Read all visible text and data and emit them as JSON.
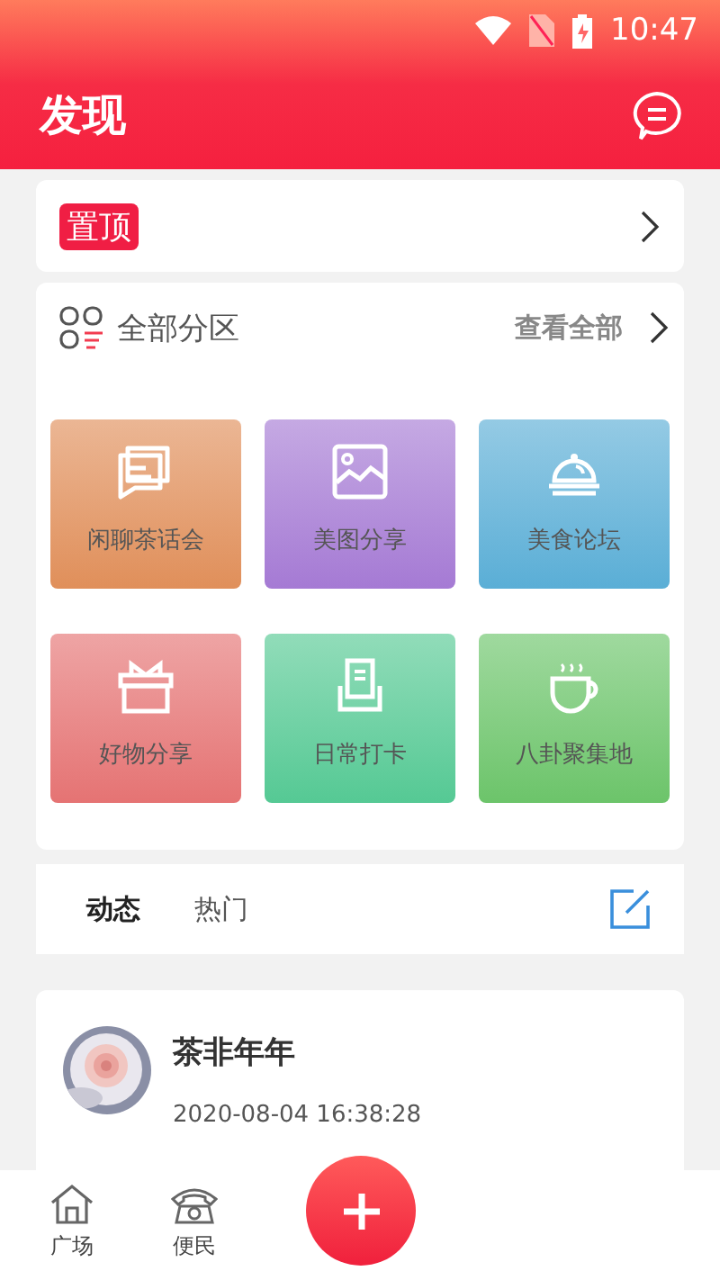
{
  "status_bar": {
    "time": "10:47"
  },
  "header": {
    "title": "发现"
  },
  "pinned": {
    "label": "置顶"
  },
  "sections": {
    "title": "全部分区",
    "view_all": "查看全部",
    "items": [
      {
        "label": "闲聊茶话会",
        "color": "#e08f5a"
      },
      {
        "label": "美图分享",
        "color": "#a57ad4"
      },
      {
        "label": "美食论坛",
        "color": "#5aaed6"
      },
      {
        "label": "好物分享",
        "color": "#e57373"
      },
      {
        "label": "日常打卡",
        "color": "#55c994"
      },
      {
        "label": "八卦聚集地",
        "color": "#6cc46a"
      }
    ]
  },
  "tabs": [
    {
      "label": "动态",
      "selected": true
    },
    {
      "label": "热门",
      "selected": false
    }
  ],
  "post": {
    "author": "茶非年年",
    "time": "2020-08-04 16:38:28"
  },
  "bottom_nav": [
    {
      "label": "广场"
    },
    {
      "label": "便民"
    }
  ]
}
